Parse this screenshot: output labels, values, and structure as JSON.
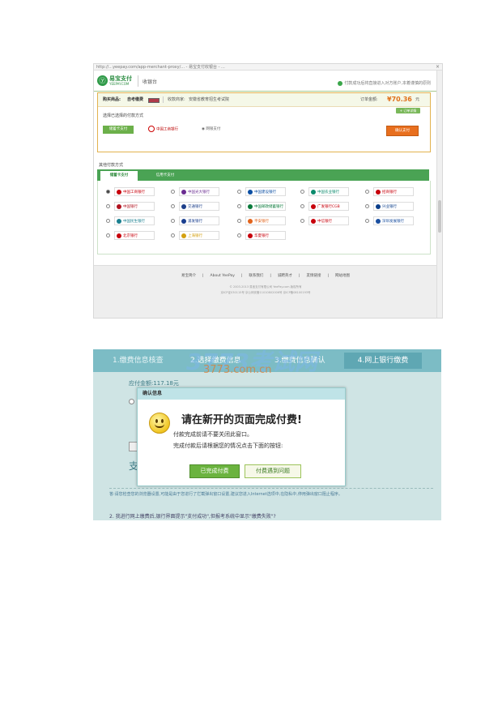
{
  "browser": {
    "url_text": "http://...yeepay.com/app-merchant-proxy/...  - 易宝支付收银台 - ..."
  },
  "cashier": {
    "logo_text": "易宝支付",
    "logo_sub": "YEEPAY.COM",
    "title": "收银台",
    "notice": "付款成功后将直接进入对方账户,本着谨慎的原则",
    "order": {
      "label": "购买商品:",
      "product": "自考缴费",
      "seller_label": "收款商家:",
      "seller": "安徽省教育招生考试院",
      "amount_label": "订单金额:",
      "amount": "¥70.36",
      "unit": "元",
      "detail_button": "+ 订单详情"
    },
    "selected": {
      "label": "选择已选择的付款方式",
      "button": "储蓄卡支付",
      "bank": "中国工商银行",
      "type": "网银支付",
      "confirm": "确认支付"
    },
    "other_label": "其他付款方式",
    "tabs": [
      {
        "label": "储蓄卡支付",
        "active": true
      },
      {
        "label": "信用卡支付",
        "active": false
      }
    ],
    "banks": [
      {
        "name": "中国工商银行",
        "color": "#c7000b",
        "selected": true
      },
      {
        "name": "中国光大银行",
        "color": "#6a2c91",
        "selected": false
      },
      {
        "name": "中国建设银行",
        "color": "#0b4ea2",
        "selected": false
      },
      {
        "name": "中国农业银行",
        "color": "#0b8a6c",
        "selected": false
      },
      {
        "name": "招商银行",
        "color": "#c7000b",
        "selected": false
      },
      {
        "name": "中国银行",
        "color": "#b1121f",
        "selected": false
      },
      {
        "name": "交通银行",
        "color": "#1d3f8a",
        "selected": false
      },
      {
        "name": "中国邮政储蓄银行",
        "color": "#0a7a3b",
        "selected": false
      },
      {
        "name": "广发银行CGB",
        "color": "#c7000b",
        "selected": false
      },
      {
        "name": "兴业银行",
        "color": "#0b3e8a",
        "selected": false
      },
      {
        "name": "中国民生银行",
        "color": "#1a7f8f",
        "selected": false
      },
      {
        "name": "浦发银行",
        "color": "#1a3f8f",
        "selected": false
      },
      {
        "name": "平安银行",
        "color": "#e2641c",
        "selected": false
      },
      {
        "name": "中信银行",
        "color": "#c7000b",
        "selected": false
      },
      {
        "name": "深圳发展银行",
        "color": "#1a4f9f",
        "selected": false
      },
      {
        "name": "北京银行",
        "color": "#c7000b",
        "selected": false
      },
      {
        "name": "上海银行",
        "color": "#d4a010",
        "selected": false
      },
      {
        "name": "华夏银行",
        "color": "#c7000b",
        "selected": false
      }
    ],
    "footer": {
      "links": [
        "易宝简介",
        "About YeePay",
        "联系我们",
        "诚聘英才",
        "友情链接",
        "网站地图"
      ],
      "copyright": "© 2003-2013 易宝支付有限公司 YeePay.com 版权所有",
      "icp": "京ICP证030115号 京公网安备11010802006号 京ICP备08100193号"
    }
  },
  "payment": {
    "watermark": "3773考试网",
    "watermark_sub": "3773.com.cn",
    "steps": [
      "1.缴费信息核查",
      "2.选择缴费信息",
      "3.缴费信息确认",
      "4.网上银行缴费"
    ],
    "paid_amount": "应付金额:117.18元",
    "bg_heading": "支",
    "bg_a1": "答:请您检查您的浏览器设置,可能是由于您进行了拦截弹出窗口设置,建议您进入Internet选项中,在隐私中,停用弹出窗口阻止程序。",
    "bg_q2": "2. 我进行网上缴费后,银行界面提示\"支付成功\",但报考系统中显示\"缴费失败\"?",
    "dialog": {
      "title": "确认信息",
      "message": "请在新开的页面完成付费!",
      "line1": "付款完成前请不要关闭此窗口。",
      "line2": "完成付款后请根据您的情况点击下面的按钮:",
      "done_button": "已完成付费",
      "problem_button": "付费遇到问题"
    }
  }
}
